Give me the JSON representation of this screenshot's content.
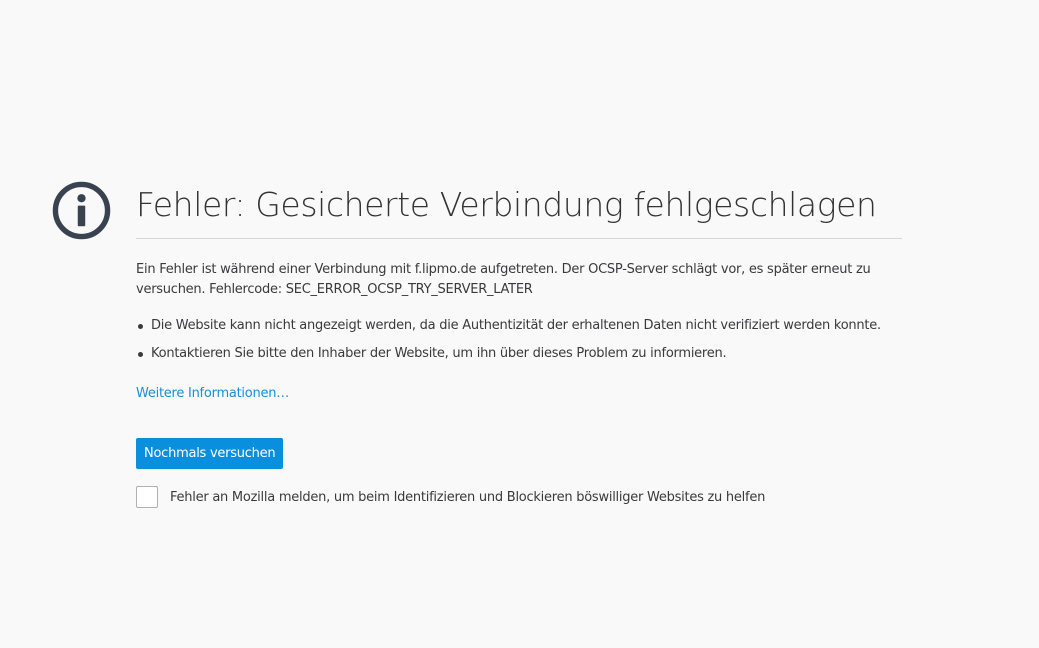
{
  "error": {
    "title": "Fehler: Gesicherte Verbindung fehlgeschlagen",
    "description": "Ein Fehler ist während einer Verbindung mit f.lipmo.de aufgetreten. Der OCSP-Server schlägt vor, es später erneut zu versuchen. Fehlercode: SEC_ERROR_OCSP_TRY_SERVER_LATER",
    "bullets": [
      "Die Website kann nicht angezeigt werden, da die Authentizität der erhaltenen Daten nicht verifiziert werden konnte.",
      "Kontaktieren Sie bitte den Inhaber der Website, um ihn über dieses Problem zu informieren."
    ],
    "more_info_label": "Weitere Informationen…",
    "retry_label": "Nochmals versuchen",
    "report_label": "Fehler an Mozilla melden, um beim Identifizieren und Blockieren böswilliger Websites zu helfen",
    "report_checked": false
  },
  "icons": {
    "error_icon": "info-icon"
  },
  "colors": {
    "background": "#f9f9fa",
    "icon": "#38434f",
    "link": "#1a8ed6",
    "button": "#0a8fde"
  }
}
